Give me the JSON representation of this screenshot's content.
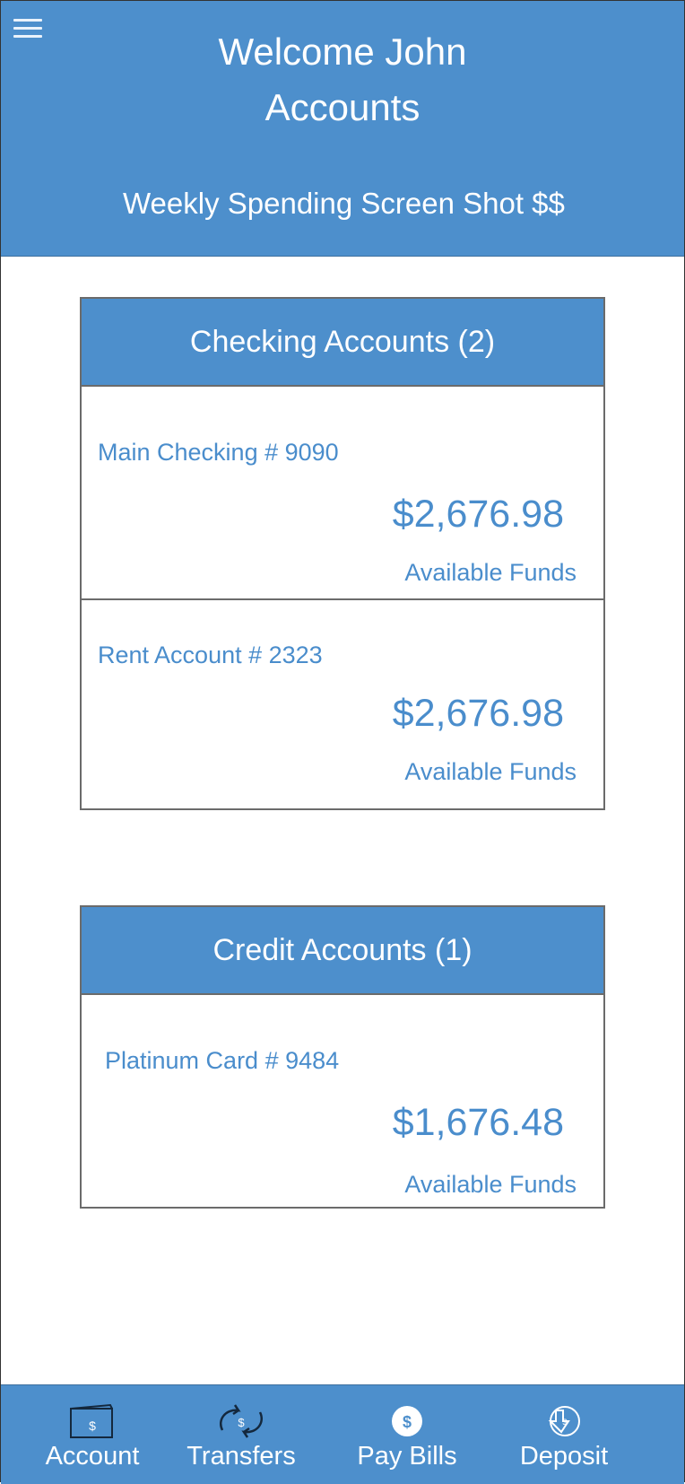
{
  "header": {
    "menu_icon": "hamburger-menu-icon",
    "welcome": "Welcome John",
    "title": "Accounts",
    "subtitle": "Weekly Spending Screen Shot $$"
  },
  "checking": {
    "heading": "Checking Accounts (2)",
    "accounts": [
      {
        "name": "Main Checking # 9090",
        "amount": "$2,676.98",
        "label": "Available Funds"
      },
      {
        "name": "Rent Account # 2323",
        "amount": "$2,676.98",
        "label": "Available Funds"
      }
    ]
  },
  "credit": {
    "heading": "Credit Accounts (1)",
    "accounts": [
      {
        "name": "Platinum Card # 9484",
        "amount": "$1,676.48",
        "label": "Available Funds"
      }
    ]
  },
  "nav": {
    "items": [
      {
        "label": "Account",
        "icon": "wallet-icon"
      },
      {
        "label": "Transfers",
        "icon": "transfer-arrows-icon"
      },
      {
        "label": "Pay Bills",
        "icon": "dollar-coin-icon"
      },
      {
        "label": "Deposit",
        "icon": "deposit-icon"
      }
    ]
  },
  "colors": {
    "primary": "#4d8fcc",
    "text_accent": "#4a8dcc",
    "border": "#6b6b6b"
  }
}
